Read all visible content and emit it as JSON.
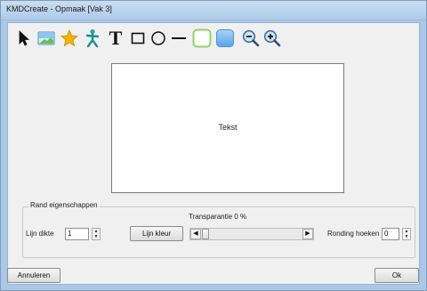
{
  "window": {
    "title": "KMDCreate - Opmaak [Vak 3]"
  },
  "toolbar": {
    "tools": [
      {
        "icon": "pointer-icon"
      },
      {
        "icon": "image-icon"
      },
      {
        "icon": "star-icon"
      },
      {
        "icon": "figure-icon"
      },
      {
        "icon": "text-tool-icon",
        "glyph": "T"
      },
      {
        "icon": "rectangle-icon"
      },
      {
        "icon": "ellipse-icon"
      },
      {
        "icon": "line-icon"
      },
      {
        "icon": "border-color-icon",
        "color": "#8fd36a"
      },
      {
        "icon": "fill-color-icon",
        "color": "#7ab8f0"
      },
      {
        "icon": "zoom-out-icon"
      },
      {
        "icon": "zoom-in-icon"
      }
    ]
  },
  "canvas": {
    "text": "Tekst"
  },
  "rand": {
    "group_label": "Rand eigenschappen",
    "thickness_label": "Lijn dikte",
    "thickness_value": "1",
    "line_color_button": "Lijn kleur",
    "transparency_label": "Transparantie 0 %",
    "transparency_percent": 0,
    "rounding_label": "Ronding hoeken",
    "rounding_value": "0"
  },
  "footer": {
    "cancel_label": "Annuleren",
    "ok_label": "Ok"
  },
  "colors": {
    "title_bar": "#b9d3ee",
    "border_swatch": "#8fd36a",
    "fill_swatch": "#7ab8f0"
  }
}
